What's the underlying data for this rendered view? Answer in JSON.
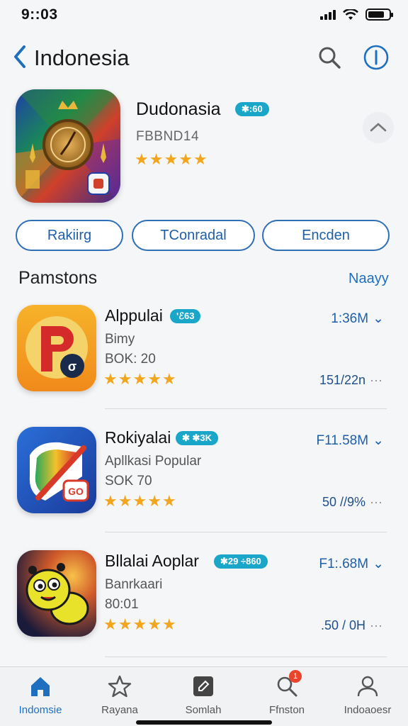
{
  "status": {
    "time": "9::03"
  },
  "nav": {
    "title": "Indonesia",
    "back_icon": "chevron-left-icon",
    "search_icon": "search-icon",
    "info_icon": "info-icon"
  },
  "header_app": {
    "name": "Dudonasia",
    "badge": "✱:60",
    "developer": "FBBND14",
    "rating_stars": 4.5
  },
  "filters": [
    "Rakiirg",
    "TConradal",
    "Encden"
  ],
  "section": {
    "title": "Pamstons",
    "link": "Naayy"
  },
  "apps": [
    {
      "name": "Alppulai",
      "badge": "ʹℰ63",
      "subtitle": "Bimy",
      "meta": "BOK: 20",
      "size": "1:36M",
      "count": "151/22n",
      "rating_stars": 4.5
    },
    {
      "name": "Rokiyalai",
      "badge": "✱ ✱3K",
      "subtitle": "Apllkasi Popular",
      "meta": "SOK 70",
      "size": "F11.58M",
      "count": "50 //9%",
      "rating_stars": 5
    },
    {
      "name": "Bllalai Aoplar",
      "badge": "✱29 ÷860",
      "subtitle": "Banrkaari",
      "meta": "80:01",
      "size": "F1:.68M",
      "count": ".50 / 0H",
      "rating_stars": 4.5
    }
  ],
  "tabs": [
    {
      "label": "Indomsie",
      "icon": "home-icon",
      "active": true
    },
    {
      "label": "Rayana",
      "icon": "star-icon",
      "active": false
    },
    {
      "label": "Somlah",
      "icon": "edit-icon",
      "active": false
    },
    {
      "label": "Ffnston",
      "icon": "search-icon",
      "active": false,
      "badge": "1"
    },
    {
      "label": "Indoaoesr",
      "icon": "person-icon",
      "active": false
    }
  ],
  "colors": {
    "accent": "#1f6fc0",
    "badge": "#1aa6c8",
    "star": "#f2a61d",
    "notification": "#e8452c"
  }
}
